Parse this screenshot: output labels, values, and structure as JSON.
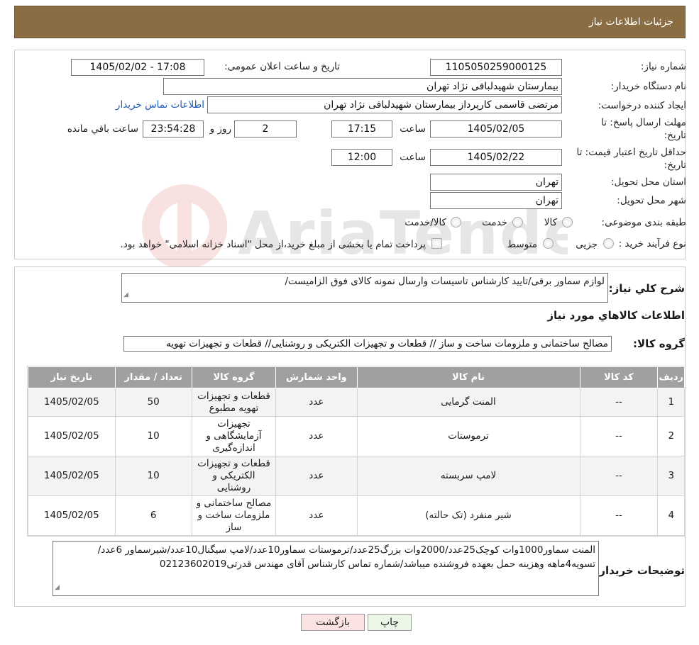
{
  "header": {
    "title": "جزئیات اطلاعات نیاز"
  },
  "form": {
    "need_number_label": "شماره نیاز:",
    "need_number": "1105050259000125",
    "announce_label": "تاریخ و ساعت اعلان عمومی:",
    "announce_value": "1405/02/02 - 17:08",
    "buyer_org_label": "نام دستگاه خریدار:",
    "buyer_org": "بیمارستان شهیدلبافی نژاد تهران",
    "requester_label": "ایجاد کننده درخواست:",
    "requester": "مرتضی  قاسمی کارپرداز بیمارستان شهیدلبافی نژاد تهران",
    "contact_link": "اطلاعات تماس خریدار",
    "deadline_label_1": "مهلت ارسال پاسخ: تا",
    "deadline_label_2": "تاریخ:",
    "deadline_date": "1405/02/05",
    "time_label": "ساعت",
    "deadline_time": "17:15",
    "days_value": "2",
    "days_label": "روز و",
    "remaining_time": "23:54:28",
    "remaining_label": "ساعت باقي مانده",
    "validity_label_1": "حداقل تاریخ اعتبار قیمت: تا",
    "validity_label_2": "تاریخ:",
    "validity_date": "1405/02/22",
    "validity_time": "12:00",
    "province_label": "استان محل تحویل:",
    "province": "تهران",
    "city_label": "شهر محل تحویل:",
    "city": "تهران",
    "category_label": "طبقه بندی موضوعی:",
    "category_options": [
      "کالا",
      "خدمت",
      "کالا/خدمت"
    ],
    "process_label": "نوع فرآیند خرید :",
    "process_options": [
      "جزیی",
      "متوسط"
    ],
    "process_note": "پرداخت تمام یا بخشی از مبلغ خرید،از محل \"اسناد خزانه اسلامی\" خواهد بود."
  },
  "watermark": {
    "text": "AriaTender.neT"
  },
  "summary": {
    "label": "شرح کلي نیاز:",
    "text": "لوازم سماور برقی/تایید کارشناس تاسیسات وارسال نمونه کالای فوق الزامیست/",
    "goods_info_title": "اطلاعات کالاهاي مورد نیاز",
    "group_label": "گروه کالا:",
    "group_value": "مصالح ساختمانی و ملزومات ساخت و ساز // قطعات و تجهیزات الکتریکی و روشنایی//  قطعات و تجهیزات تهویه"
  },
  "table": {
    "headers": [
      "ردیف",
      "کد کالا",
      "نام کالا",
      "واحد شمارش",
      "گروه کالا",
      "تعداد / مقدار",
      "تاریخ نیاز"
    ],
    "rows": [
      {
        "row": "1",
        "code": "--",
        "name": "المنت گرمایی",
        "unit": "عدد",
        "group": "قطعات و تجهیزات تهویه مطبوع",
        "qty": "50",
        "date": "1405/02/05"
      },
      {
        "row": "2",
        "code": "--",
        "name": "ترموستات",
        "unit": "عدد",
        "group": "تجهیزات آزمایشگاهی و اندازه‌گیری",
        "qty": "10",
        "date": "1405/02/05"
      },
      {
        "row": "3",
        "code": "--",
        "name": "لامپ سربسته",
        "unit": "عدد",
        "group": "قطعات و تجهیزات الکتریکی و روشنایی",
        "qty": "10",
        "date": "1405/02/05"
      },
      {
        "row": "4",
        "code": "--",
        "name": "شیر منفرد (تک حالته)",
        "unit": "عدد",
        "group": "مصالح ساختمانی و ملزومات ساخت و ساز",
        "qty": "6",
        "date": "1405/02/05"
      }
    ]
  },
  "buyer_notes": {
    "label": "توضیحات خریدار:",
    "text": "المنت سماور1000وات کوچک25عدد/2000وات بزرگ25عدد/ترموستات سماور10عدد/لامپ سیگنال10عدد/شیرسماور 6عدد/تسویه4ماهه وهزینه حمل بعهده فروشنده میباشد/شماره تماس کارشناس آقای مهندس قدرتی02123602019"
  },
  "buttons": {
    "print": "چاپ",
    "back": "بازگشت"
  },
  "colors": {
    "header_bg": "#8a6d43",
    "link": "#1e5bb8",
    "back_button_bg": "#fbe3e3",
    "print_button_bg": "#eaf7e6"
  }
}
